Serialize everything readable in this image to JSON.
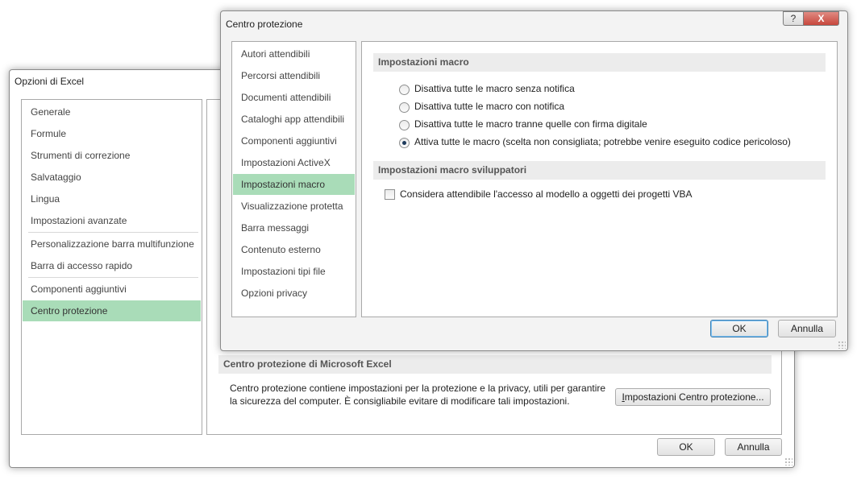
{
  "excel_options": {
    "title": "Opzioni di Excel",
    "nav_items": [
      "Generale",
      "Formule",
      "Strumenti di correzione",
      "Salvataggio",
      "Lingua",
      "Impostazioni avanzate",
      "Personalizzazione barra multifunzione",
      "Barra di accesso rapido",
      "Componenti aggiuntivi",
      "Centro protezione"
    ],
    "selected_nav": "Centro protezione",
    "section_title": "Centro protezione di Microsoft Excel",
    "description_line1": "Centro protezione contiene impostazioni per la protezione e la privacy, utili per garantire",
    "description_line2": "la sicurezza del computer. È consigliabile evitare di modificare tali impostazioni.",
    "trust_center_button": "Impostazioni Centro protezione...",
    "ok_label": "OK",
    "cancel_label": "Annulla"
  },
  "trust_center": {
    "title": "Centro protezione",
    "help_label": "?",
    "close_label": "X",
    "nav_items": [
      "Autori attendibili",
      "Percorsi attendibili",
      "Documenti attendibili",
      "Cataloghi app attendibili",
      "Componenti aggiuntivi",
      "Impostazioni ActiveX",
      "Impostazioni macro",
      "Visualizzazione protetta",
      "Barra messaggi",
      "Contenuto esterno",
      "Impostazioni tipi file",
      "Opzioni privacy"
    ],
    "selected_nav": "Impostazioni macro",
    "macro_section_title": "Impostazioni macro",
    "macro_options": [
      "Disattiva tutte le macro senza notifica",
      "Disattiva tutte le macro con notifica",
      "Disattiva tutte le macro tranne quelle con firma digitale",
      "Attiva tutte le macro (scelta non consigliata; potrebbe venire eseguito codice pericoloso)"
    ],
    "selected_macro_option": 3,
    "developer_section_title": "Impostazioni macro sviluppatori",
    "vba_checkbox_label": "Considera attendibile l'accesso al modello a oggetti dei progetti VBA",
    "vba_checkbox_checked": false,
    "ok_label": "OK",
    "cancel_label": "Annulla"
  },
  "colors": {
    "selected_nav": "#a9dcb8",
    "section_header_bg": "#ececec",
    "close_button": "#c7483d"
  }
}
